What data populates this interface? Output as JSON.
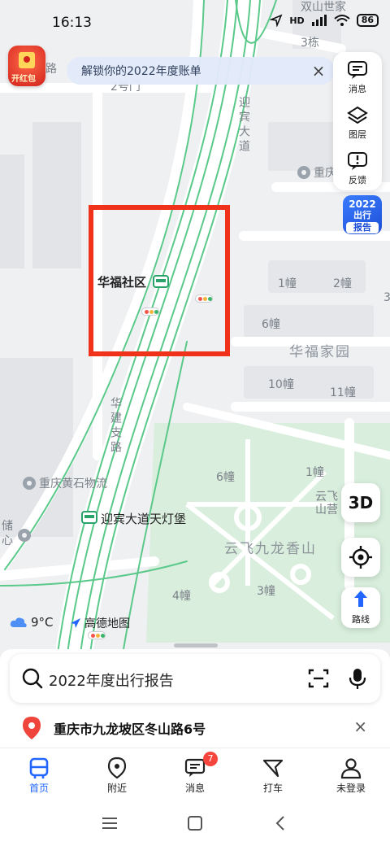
{
  "status_bar": {
    "time": "16:13",
    "network": "HD",
    "battery": "86"
  },
  "red_packet": {
    "label": "开红包"
  },
  "banner": {
    "text": "解锁你的2022年度账单",
    "close": "×"
  },
  "side_panel": {
    "message": "消息",
    "layers": "图层",
    "feedback": "反馈"
  },
  "report_badge": {
    "line1": "2022",
    "line2": "出行",
    "line3": "报告"
  },
  "map": {
    "labels": {
      "road_yingbin": "迎宾大道",
      "road_huajianzhi": "华建支路",
      "community_huafu": "华福社区",
      "huafu_garden": "华福家园",
      "bldg_1": "1幢",
      "bldg_2": "2幢",
      "bldg_6": "6幢",
      "bldg_10": "10幢",
      "bldg_11": "11幢",
      "bldg_3_top": "3栋",
      "bldg_6b": "6幢",
      "bldg_1b": "1幢",
      "bldg_4": "4幢",
      "bldg_3": "3幢",
      "huangshi": "重庆黄石物流",
      "tiandengbao": "迎宾大道天灯堡",
      "yunfei": "云飞九龙香山",
      "yunfei_short_1": "云飞",
      "yunfei_short_2": "山营",
      "chongqing_top": "重庆先",
      "top_cut": "双山世家",
      "road_cut": "路",
      "left_cut_1": "储",
      "left_cut_2": "心",
      "gate_2": "2号门",
      "edge_3": "3"
    }
  },
  "controls": {
    "btn3d": "3D",
    "route": "路线"
  },
  "weather": {
    "temp": "9°C"
  },
  "logo": {
    "text": "高德地图"
  },
  "search": {
    "placeholder": "2022年度出行报告"
  },
  "address": {
    "text": "重庆市九龙坡区冬山路6号",
    "close": "×"
  },
  "tabs": [
    {
      "label": "首页"
    },
    {
      "label": "附近"
    },
    {
      "label": "消息",
      "badge": "7"
    },
    {
      "label": "打车"
    },
    {
      "label": "未登录"
    }
  ],
  "colors": {
    "accent": "#2266ff",
    "highlight_box": "#f0321a",
    "green_area": "#d9eedd",
    "road_green": "#4fc27f"
  }
}
